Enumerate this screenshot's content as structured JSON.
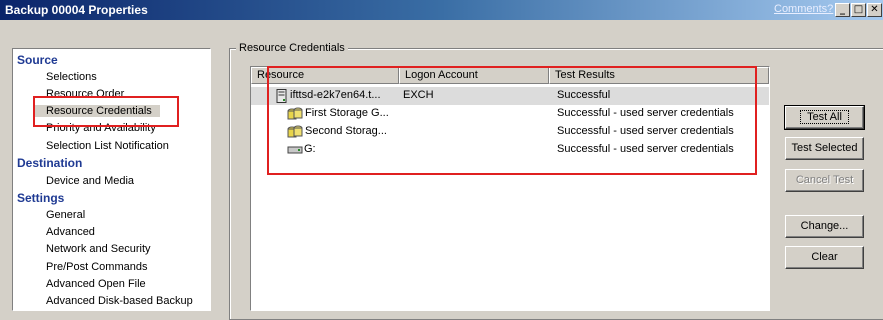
{
  "window": {
    "title": "Backup 00004 Properties",
    "comments_link": "Comments?",
    "controls": {
      "minimize": "_",
      "maximize": "□",
      "close": "✕"
    }
  },
  "nav": {
    "groups": [
      {
        "label": "Source",
        "items": [
          "Selections",
          "Resource Order",
          "Resource Credentials",
          "Priority and Availability",
          "Selection List Notification"
        ]
      },
      {
        "label": "Destination",
        "items": [
          "Device and Media"
        ]
      },
      {
        "label": "Settings",
        "items": [
          "General",
          "Advanced",
          "Network and Security",
          "Pre/Post Commands",
          "Advanced Open File",
          "Advanced Disk-based Backup"
        ]
      }
    ],
    "selected": "Resource Credentials"
  },
  "frame": {
    "legend": "Resource Credentials"
  },
  "table": {
    "columns": [
      "Resource",
      "Logon Account",
      "Test Results"
    ],
    "rows": [
      {
        "icon": "server-icon",
        "resource": "ifttsd-e2k7en64.t...",
        "account": "EXCH",
        "result": "Successful"
      },
      {
        "icon": "storage-group-icon",
        "resource": "First Storage G...",
        "account": "",
        "result": "Successful - used server credentials"
      },
      {
        "icon": "storage-group-icon",
        "resource": "Second Storag...",
        "account": "",
        "result": "Successful - used server credentials"
      },
      {
        "icon": "drive-icon",
        "resource": "G:",
        "account": "",
        "result": "Successful - used server credentials"
      }
    ]
  },
  "buttons": {
    "test_all": "Test All",
    "test_selected": "Test Selected",
    "cancel_test": "Cancel Test",
    "change": "Change...",
    "clear": "Clear"
  },
  "colors": {
    "highlight": "#e02020",
    "nav_group": "#1f3a93",
    "titlebar": "#0a246a"
  }
}
